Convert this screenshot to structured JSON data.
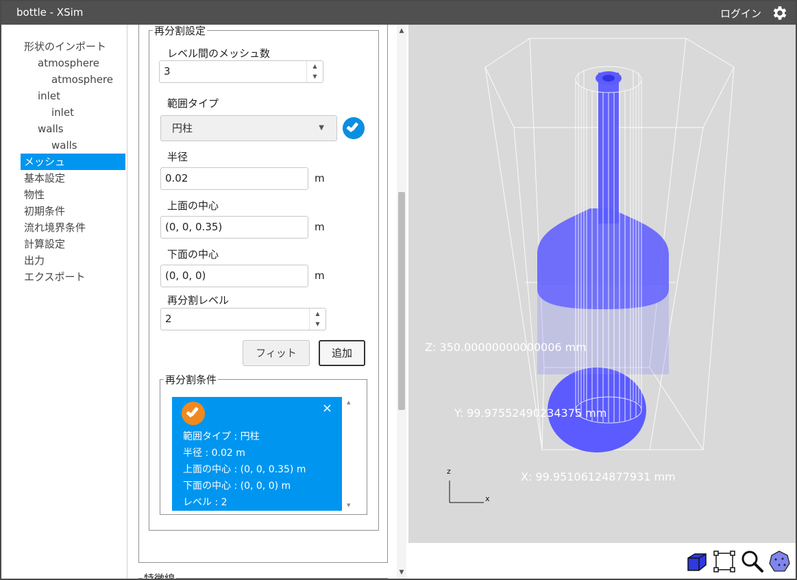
{
  "window": {
    "title": "bottle - XSim",
    "login": "ログイン"
  },
  "sidebar": {
    "items": [
      {
        "label": "形状のインポート",
        "level": 0
      },
      {
        "label": "atmosphere",
        "level": 1
      },
      {
        "label": "atmosphere",
        "level": 2
      },
      {
        "label": "inlet",
        "level": 1
      },
      {
        "label": "inlet",
        "level": 2
      },
      {
        "label": "walls",
        "level": 1
      },
      {
        "label": "walls",
        "level": 2
      },
      {
        "label": "メッシュ",
        "level": 0,
        "active": true
      },
      {
        "label": "基本設定",
        "level": 0
      },
      {
        "label": "物性",
        "level": 0
      },
      {
        "label": "初期条件",
        "level": 0
      },
      {
        "label": "流れ境界条件",
        "level": 0
      },
      {
        "label": "計算設定",
        "level": 0
      },
      {
        "label": "出力",
        "level": 0
      },
      {
        "label": "エクスポート",
        "level": 0
      }
    ]
  },
  "refine": {
    "legend": "再分割設定",
    "mesh_between_levels_label": "レベル間のメッシュ数",
    "mesh_between_levels_value": "3",
    "range_type_label": "範囲タイプ",
    "range_type_value": "円柱",
    "radius_label": "半径",
    "radius_value": "0.02",
    "radius_unit": "m",
    "top_center_label": "上面の中心",
    "top_center_value": "(0, 0, 0.35)",
    "top_center_unit": "m",
    "bottom_center_label": "下面の中心",
    "bottom_center_value": "(0, 0, 0)",
    "bottom_center_unit": "m",
    "level_label": "再分割レベル",
    "level_value": "2",
    "fit_button": "フィット",
    "add_button": "追加"
  },
  "conditions": {
    "legend": "再分割条件",
    "card": {
      "line1": "範囲タイプ : 円柱",
      "line2": "半径 : 0.02 m",
      "line3": "上面の中心 : (0, 0, 0.35) m",
      "line4": "下面の中心 : (0, 0, 0) m",
      "line5": "レベル : 2",
      "close": "×"
    }
  },
  "next_section": {
    "legend": "特徴線"
  },
  "viewer": {
    "z_label": "Z: 350.00000000000006 mm",
    "y_label": "Y: 99.97552490234375 mm",
    "x_label": "X: 99.95106124877931 mm",
    "axis_z": "z",
    "axis_x": "x",
    "colors": {
      "background": "#d9d9d9",
      "bottle": "#5b5bff",
      "wire": "#ffffff"
    }
  },
  "toolbar": {
    "tools": [
      "cube-icon",
      "fit-frame-icon",
      "zoom-icon",
      "mesh-sphere-icon"
    ]
  }
}
